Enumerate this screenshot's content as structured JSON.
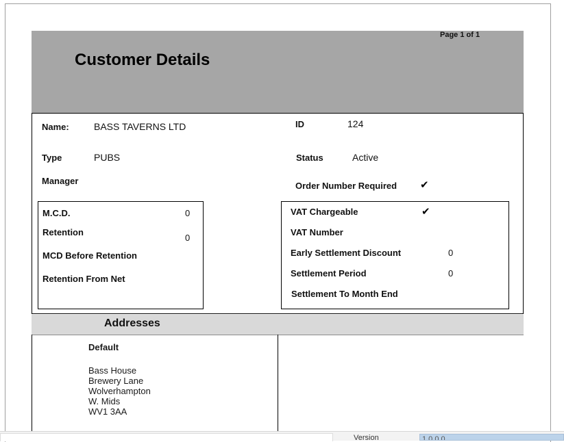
{
  "report": {
    "page_indicator": "Page 1 of 1",
    "title": "Customer Details"
  },
  "customer": {
    "name_label": "Name:",
    "name_value": "BASS TAVERNS LTD",
    "id_label": "ID",
    "id_value": "124",
    "type_label": "Type",
    "type_value": "PUBS",
    "status_label": "Status",
    "status_value": "Active",
    "manager_label": "Manager",
    "order_number_label": "Order Number Required",
    "order_number_checked": "✔"
  },
  "mcd_section": {
    "mcd_label": "M.C.D.",
    "mcd_value": "0",
    "retention_label": "Retention",
    "retention_value": "0",
    "mcd_before_label": "MCD Before Retention",
    "retention_net_label": "Retention From Net"
  },
  "vat_section": {
    "vat_chargeable_label": "VAT Chargeable",
    "vat_chargeable_checked": "✔",
    "vat_number_label": "VAT Number",
    "early_discount_label": "Early Settlement Discount",
    "early_discount_value": "0",
    "settlement_period_label": "Settlement Period",
    "settlement_period_value": "0",
    "settlement_month_end_label": "Settlement To Month End"
  },
  "addresses": {
    "section_title": "Addresses",
    "default_label": "Default",
    "lines": [
      "Bass House",
      "Brewery Lane",
      "Wolverhampton",
      "W. Mids",
      "WV1 3AA"
    ]
  },
  "footer": {
    "version_label": "Version",
    "version_value": "1.0.0.0"
  }
}
